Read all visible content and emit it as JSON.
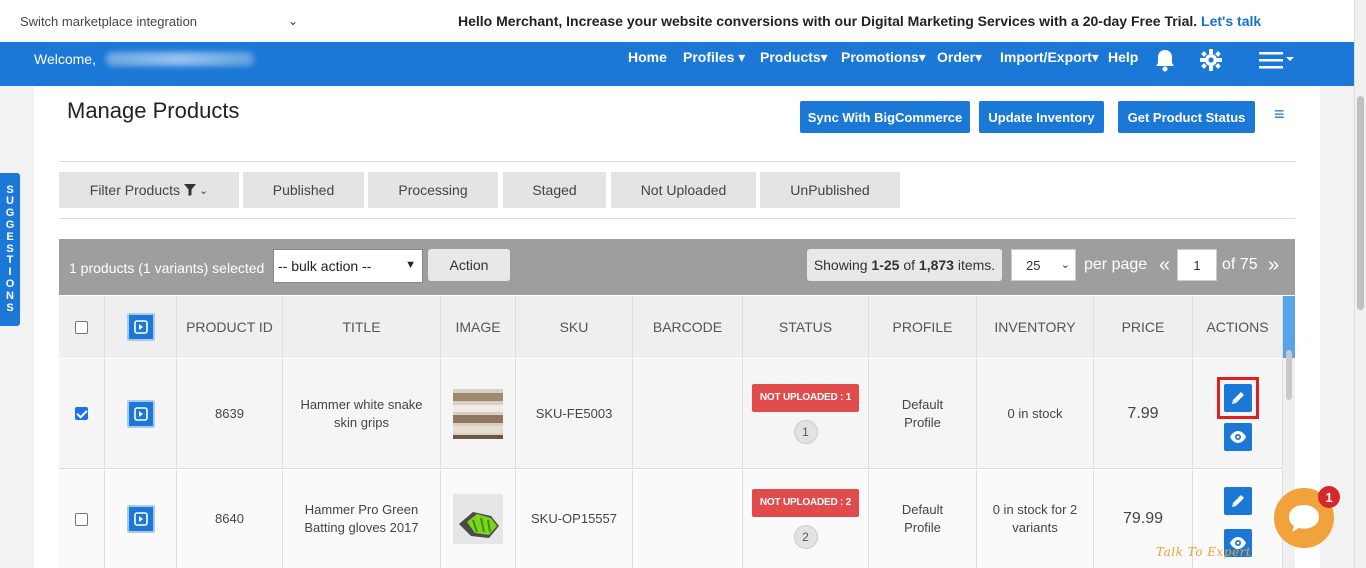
{
  "topbar": {
    "marketplace_label": "Switch marketplace integration",
    "promo_text": "Hello Merchant, Increase your website conversions with our Digital Marketing Services with a 20-day Free Trial.",
    "promo_link": "Let's talk"
  },
  "navbar": {
    "welcome": "Welcome,",
    "items": [
      "Home",
      "Profiles ▾",
      "Products▾",
      "Promotions▾",
      "Order▾",
      "Import/Export▾",
      "Help"
    ]
  },
  "suggestions": [
    "S",
    "U",
    "G",
    "G",
    "E",
    "S",
    "T",
    "I",
    "O",
    "N",
    "S"
  ],
  "page": {
    "title": "Manage Products",
    "buttons": [
      "Sync With BigCommerce",
      "Update Inventory",
      "Get Product Status"
    ]
  },
  "tabs": {
    "filter": "Filter Products",
    "items": [
      "Published",
      "Processing",
      "Staged",
      "Not Uploaded",
      "UnPublished"
    ]
  },
  "bulk": {
    "selected_info": "1 products (1 variants) selected",
    "select_value": "-- bulk action --",
    "action_label": "Action",
    "showing_prefix": "Showing ",
    "showing_range": "1-25",
    "showing_of": " of ",
    "showing_total": "1,873",
    "showing_suffix": " items.",
    "per_page_value": "25",
    "per_page_label": "per page",
    "page_prev": "«",
    "page_value": "1",
    "page_of": "of 75",
    "page_next": "»"
  },
  "table": {
    "headers": [
      "PRODUCT ID",
      "TITLE",
      "IMAGE",
      "SKU",
      "BARCODE",
      "STATUS",
      "PROFILE",
      "INVENTORY",
      "PRICE",
      "ACTIONS"
    ],
    "rows": [
      {
        "checked": true,
        "product_id": "8639",
        "title": "Hammer white snake skin grips",
        "sku": "SKU-FE5003",
        "barcode": "",
        "status": "NOT UPLOADED : 1",
        "status_count": "1",
        "profile": "Default Profile",
        "inventory": "0 in stock",
        "price": "7.99"
      },
      {
        "checked": false,
        "product_id": "8640",
        "title": "Hammer Pro Green Batting gloves 2017",
        "sku": "SKU-OP15557",
        "barcode": "",
        "status": "NOT UPLOADED : 2",
        "status_count": "2",
        "profile": "Default Profile",
        "inventory": "0 in stock for 2 variants",
        "price": "79.99"
      }
    ]
  },
  "chat": {
    "badge": "1",
    "label": "Talk To Expert"
  },
  "colors": {
    "brand_blue": "#1b78d6",
    "status_red": "#e04c4c",
    "highlight_red": "#e02020"
  }
}
